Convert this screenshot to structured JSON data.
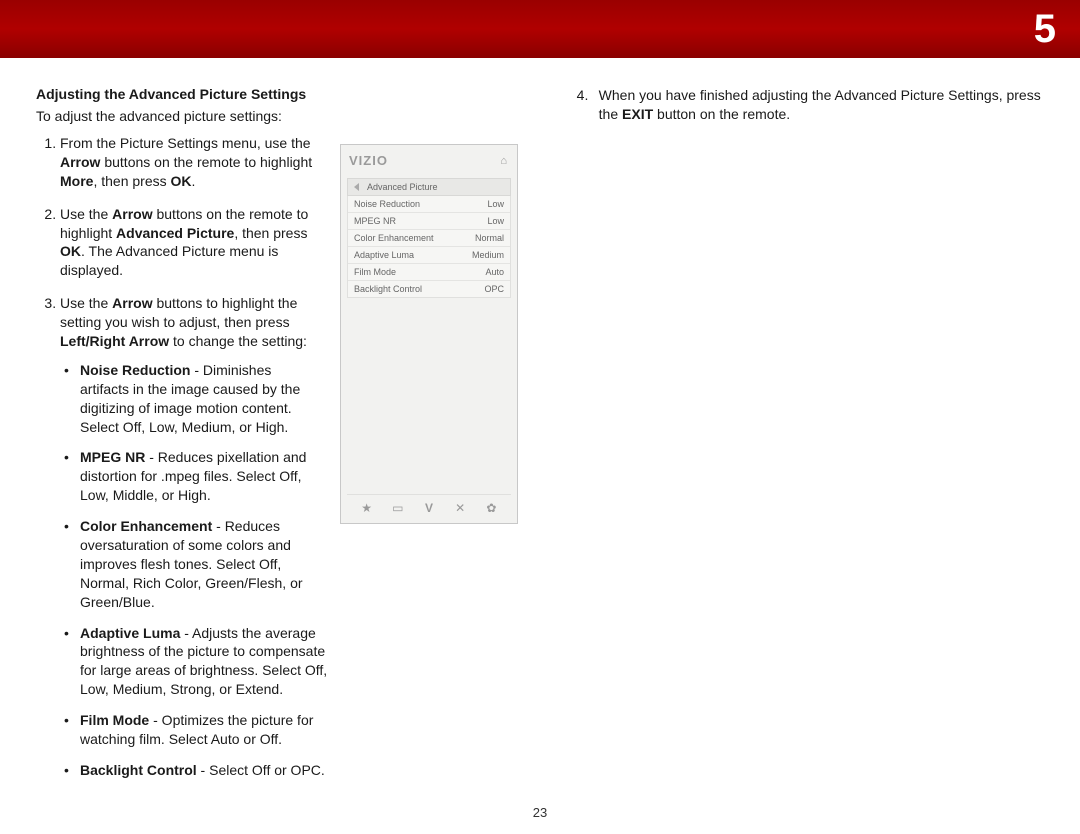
{
  "chapter": "5",
  "page_number": "23",
  "section_title": "Adjusting the Advanced Picture Settings",
  "intro": "To adjust the advanced picture settings:",
  "vizio": {
    "logo": "VIZIO",
    "breadcrumb": "Advanced Picture",
    "rows": [
      {
        "label": "Noise Reduction",
        "value": "Low"
      },
      {
        "label": "MPEG NR",
        "value": "Low"
      },
      {
        "label": "Color Enhancement",
        "value": "Normal"
      },
      {
        "label": "Adaptive Luma",
        "value": "Medium"
      },
      {
        "label": "Film Mode",
        "value": "Auto"
      },
      {
        "label": "Backlight Control",
        "value": "OPC"
      }
    ],
    "icons": {
      "star": "★",
      "wide": "▭",
      "v": "V",
      "x": "✕",
      "gear": "✿"
    }
  },
  "steps": {
    "s1_a": "From the Picture Settings menu, use the ",
    "s1_b1": "Arrow",
    "s1_c": " buttons on the remote to highlight ",
    "s1_b2": "More",
    "s1_d": ", then press ",
    "s1_b3": "OK",
    "s1_e": ".",
    "s2_a": "Use the ",
    "s2_b1": "Arrow",
    "s2_c": " buttons on the remote to highlight ",
    "s2_b2": "Advanced Picture",
    "s2_d": ", then press ",
    "s2_b3": "OK",
    "s2_e": ". The Advanced Picture menu is displayed.",
    "s3_a": "Use the ",
    "s3_b1": "Arrow",
    "s3_c": " buttons to highlight the setting you wish to adjust, then press ",
    "s3_b2": "Left/Right Arrow",
    "s3_d": " to change the setting:",
    "s4_a": "When you have finished adjusting the Advanced Picture Settings, press the ",
    "s4_b1": "EXIT",
    "s4_c": " button on the remote."
  },
  "bullets": {
    "noise_b": "Noise Reduction",
    "noise_t": " - Diminishes artifacts in the image caused by the digitizing of image motion content. Select Off, Low, Medium, or High.",
    "mpeg_b": "MPEG NR",
    "mpeg_t": " - Reduces pixellation and distortion for .mpeg files. Select Off, Low, Middle, or High.",
    "color_b": "Color Enhancement",
    "color_t": " - Reduces oversaturation of some colors and improves flesh tones. Select Off, Normal, Rich Color, Green/Flesh, or Green/Blue.",
    "luma_b": "Adaptive Luma",
    "luma_t": " - Adjusts the average brightness of the picture to compensate for large areas of brightness. Select Off, Low, Medium, Strong, or Extend.",
    "film_b": "Film Mode",
    "film_t": " - Optimizes the picture for watching film. Select Auto or Off.",
    "back_b": "Backlight Control",
    "back_t": " - Select Off or OPC."
  }
}
